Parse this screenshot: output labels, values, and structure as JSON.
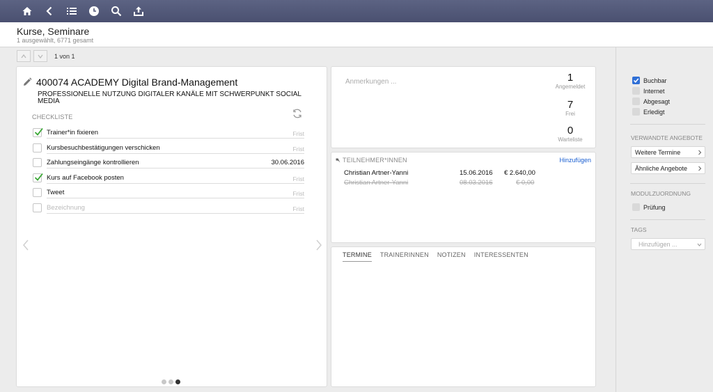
{
  "toolbar": {
    "icons": [
      "home-icon",
      "back-icon",
      "list-icon",
      "clock-icon",
      "search-icon",
      "export-icon"
    ]
  },
  "header": {
    "title": "Kurse, Seminare",
    "subtitle": "1 ausgewählt, 6771 gesamt"
  },
  "pager": {
    "count": "1 von 1"
  },
  "course": {
    "title": "400074 ACADEMY Digital Brand-Management",
    "subtitle": "PROFESSIONELLE NUTZUNG DIGITALER KANÄLE MIT SCHWERPUNKT SOCIAL MEDIA",
    "checklist_label": "CHECKLISTE",
    "checklist": [
      {
        "text": "Trainer*in fixieren",
        "date": "Frist",
        "checked": true
      },
      {
        "text": "Kursbesuchbestätigungen verschicken",
        "date": "Frist",
        "checked": false
      },
      {
        "text": "Zahlungseingänge kontrollieren",
        "date": "30.06.2016",
        "checked": false
      },
      {
        "text": "Kurs auf Facebook posten",
        "date": "Frist",
        "checked": true
      },
      {
        "text": "Tweet",
        "date": "Frist",
        "checked": false
      },
      {
        "text": "Bezeichnung",
        "date": "Frist",
        "checked": false,
        "placeholder": true
      }
    ],
    "page_dots": 3,
    "active_dot": 3
  },
  "notes": {
    "placeholder": "Anmerkungen ...",
    "stats": [
      {
        "value": "1",
        "label": "Angemeldet"
      },
      {
        "value": "7",
        "label": "Frei"
      },
      {
        "value": "0",
        "label": "Warteliste"
      }
    ]
  },
  "participants": {
    "label": "TEILNEHMER*INNEN",
    "add_label": "Hinzufügen",
    "rows": [
      {
        "name": "Christian Artner-Yanni",
        "date": "15.06.2016",
        "amount": "€ 2.640,00",
        "cancelled": false
      },
      {
        "name": "Christian Artner-Yanni",
        "date": "08.03.2016",
        "amount": "€ 0,00",
        "cancelled": true
      }
    ]
  },
  "tabs": [
    "TERMINE",
    "TRAINERINNEN",
    "NOTIZEN",
    "INTERESSENTEN"
  ],
  "sidebar": {
    "status_checks": [
      {
        "label": "Buchbar",
        "checked": true
      },
      {
        "label": "Internet",
        "checked": false
      },
      {
        "label": "Abgesagt",
        "checked": false
      },
      {
        "label": "Erledigt",
        "checked": false
      }
    ],
    "related_title": "VERWANDTE ANGEBOTE",
    "related_buttons": [
      "Weitere Termine",
      "Ähnliche Angebote"
    ],
    "module_title": "MODULZUORDNUNG",
    "module_checks": [
      {
        "label": "Prüfung",
        "checked": false
      }
    ],
    "tags_title": "TAGS",
    "tags_placeholder": "Hinzufügen ..."
  },
  "colors": {
    "toolbar": "#4f5575",
    "accent": "#2f6fd6",
    "link": "#1a5fd1",
    "check_green": "#3aa835"
  }
}
